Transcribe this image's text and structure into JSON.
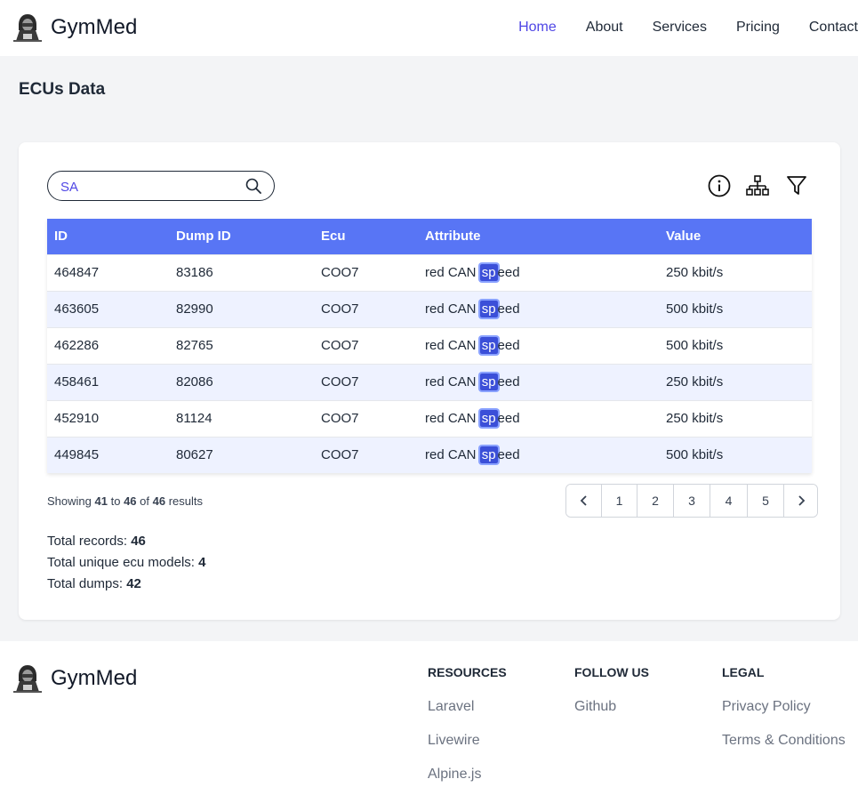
{
  "brand": {
    "name": "GymMed"
  },
  "nav": [
    {
      "label": "Home",
      "active": true
    },
    {
      "label": "About",
      "active": false
    },
    {
      "label": "Services",
      "active": false
    },
    {
      "label": "Pricing",
      "active": false
    },
    {
      "label": "Contact",
      "active": false
    }
  ],
  "page": {
    "title": "ECUs Data"
  },
  "search": {
    "value": "SA",
    "placeholder": ""
  },
  "toolbar": {
    "icons": [
      "info-icon",
      "hierarchy-icon",
      "filter-icon"
    ]
  },
  "table": {
    "columns": [
      "ID",
      "Dump ID",
      "Ecu",
      "Attribute",
      "Value"
    ],
    "highlight": "sp",
    "rows": [
      {
        "id": "464847",
        "dump_id": "83186",
        "ecu": "COO7",
        "attr_pre": "red CAN ",
        "attr_hl": "sp",
        "attr_post": "eed",
        "value": "250 kbit/s"
      },
      {
        "id": "463605",
        "dump_id": "82990",
        "ecu": "COO7",
        "attr_pre": "red CAN ",
        "attr_hl": "sp",
        "attr_post": "eed",
        "value": "500 kbit/s"
      },
      {
        "id": "462286",
        "dump_id": "82765",
        "ecu": "COO7",
        "attr_pre": "red CAN ",
        "attr_hl": "sp",
        "attr_post": "eed",
        "value": "500 kbit/s"
      },
      {
        "id": "458461",
        "dump_id": "82086",
        "ecu": "COO7",
        "attr_pre": "red CAN ",
        "attr_hl": "sp",
        "attr_post": "eed",
        "value": "250 kbit/s"
      },
      {
        "id": "452910",
        "dump_id": "81124",
        "ecu": "COO7",
        "attr_pre": "red CAN ",
        "attr_hl": "sp",
        "attr_post": "eed",
        "value": "250 kbit/s"
      },
      {
        "id": "449845",
        "dump_id": "80627",
        "ecu": "COO7",
        "attr_pre": "red CAN ",
        "attr_hl": "sp",
        "attr_post": "eed",
        "value": "500 kbit/s"
      }
    ]
  },
  "results": {
    "prefix": "Showing",
    "from": "41",
    "to_word": "to",
    "to": "46",
    "of_word": "of",
    "total": "46",
    "suffix": "results"
  },
  "pagination": {
    "pages": [
      "1",
      "2",
      "3",
      "4",
      "5"
    ]
  },
  "totals": [
    {
      "label": "Total records:",
      "value": "46"
    },
    {
      "label": "Total unique ecu models:",
      "value": "4"
    },
    {
      "label": "Total dumps:",
      "value": "42"
    }
  ],
  "footer": {
    "brand": "GymMed",
    "columns": [
      {
        "heading": "Resources",
        "links": [
          "Laravel",
          "Livewire",
          "Alpine.js"
        ]
      },
      {
        "heading": "Follow us",
        "links": [
          "Github"
        ]
      },
      {
        "heading": "Legal",
        "links": [
          "Privacy Policy",
          "Terms & Conditions"
        ]
      }
    ]
  },
  "colors": {
    "accent": "#4f46e5",
    "table_header": "#5875f5",
    "row_alt": "#eef2ff",
    "highlight": "#3b4fd8"
  }
}
